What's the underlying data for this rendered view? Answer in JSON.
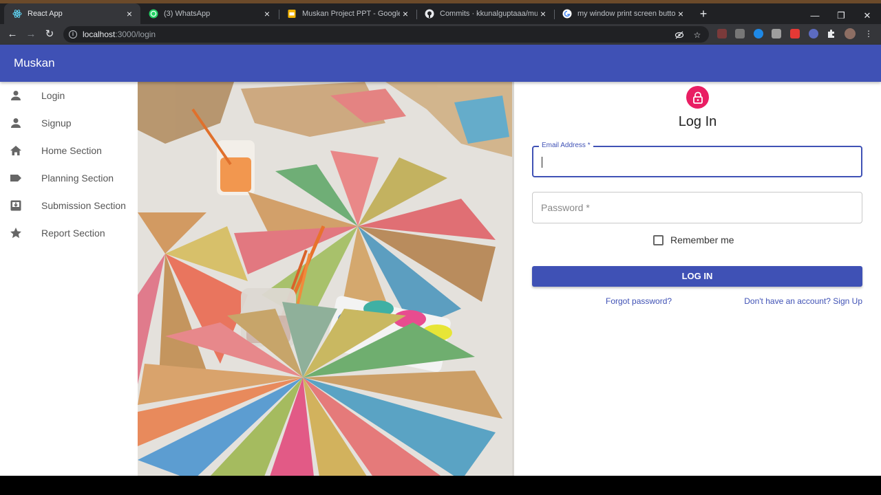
{
  "browser": {
    "tabs": [
      {
        "title": "React App",
        "icon": "react-icon",
        "active": true
      },
      {
        "title": "(3) WhatsApp",
        "icon": "whatsapp-icon",
        "active": false
      },
      {
        "title": "Muskan Project PPT - Google Slid",
        "icon": "google-slides-icon",
        "active": false
      },
      {
        "title": "Commits · kkunalguptaaa/muska",
        "icon": "github-icon",
        "active": false
      },
      {
        "title": "my window print screen button s",
        "icon": "google-icon",
        "active": false
      }
    ],
    "new_tab_label": "+",
    "url_host": "localhost",
    "url_path": ":3000/login",
    "colors": {
      "tabstrip": "#202124",
      "toolbar": "#35363a",
      "accent": "#6b4a2a"
    }
  },
  "app": {
    "brand": "Muskan",
    "colors": {
      "primary": "#3f51b5",
      "secondary": "#e91e63"
    }
  },
  "sidebar": {
    "items": [
      {
        "label": "Login",
        "icon": "person-icon"
      },
      {
        "label": "Signup",
        "icon": "person-icon"
      },
      {
        "label": "Home Section",
        "icon": "home-icon"
      },
      {
        "label": "Planning Section",
        "icon": "label-icon"
      },
      {
        "label": "Submission Section",
        "icon": "inbox-download-icon"
      },
      {
        "label": "Report Section",
        "icon": "star-icon"
      }
    ]
  },
  "login": {
    "title": "Log In",
    "email_label": "Email Address *",
    "email_value": "",
    "password_placeholder": "Password *",
    "remember_label": "Remember me",
    "submit_label": "LOG IN",
    "forgot_link": "Forgot password?",
    "signup_link": "Don't have an account? Sign Up"
  },
  "image": {
    "subject": "paper-craft-flowers-photo"
  }
}
